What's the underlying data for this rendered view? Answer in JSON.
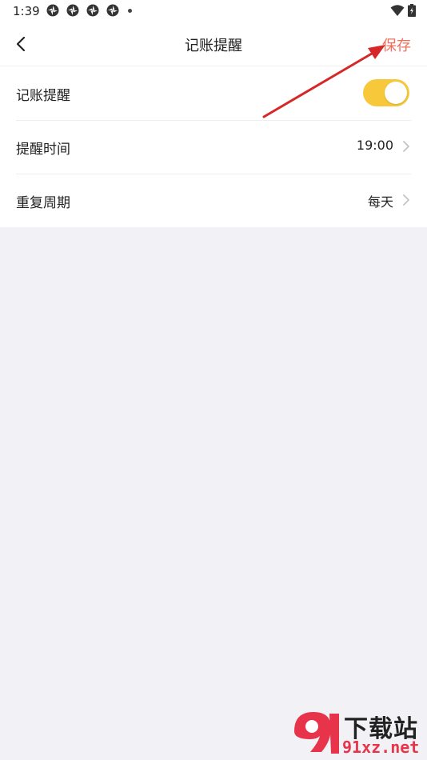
{
  "status_bar": {
    "time": "1:39",
    "notification_icons": [
      "aperture-icon",
      "aperture-icon",
      "aperture-icon",
      "aperture-icon"
    ],
    "wifi_icon": "wifi-icon",
    "battery_icon": "battery-charging-icon"
  },
  "header": {
    "back_icon": "chevron-left-icon",
    "title": "记账提醒",
    "save_label": "保存",
    "save_color": "#f26d5b"
  },
  "settings": {
    "reminder": {
      "label": "记账提醒",
      "enabled": true,
      "toggle_color": "#f7c93a"
    },
    "time": {
      "label": "提醒时间",
      "value": "19:00"
    },
    "repeat": {
      "label": "重复周期",
      "value": "每天"
    }
  },
  "annotation": {
    "arrow_color": "#d62828"
  },
  "watermark": {
    "logo_text": "9",
    "text": "下载站",
    "url": "91xz.net",
    "accent": "#e8344a"
  },
  "colors": {
    "page_background": "#f2f2f6",
    "card_background": "#ffffff"
  }
}
